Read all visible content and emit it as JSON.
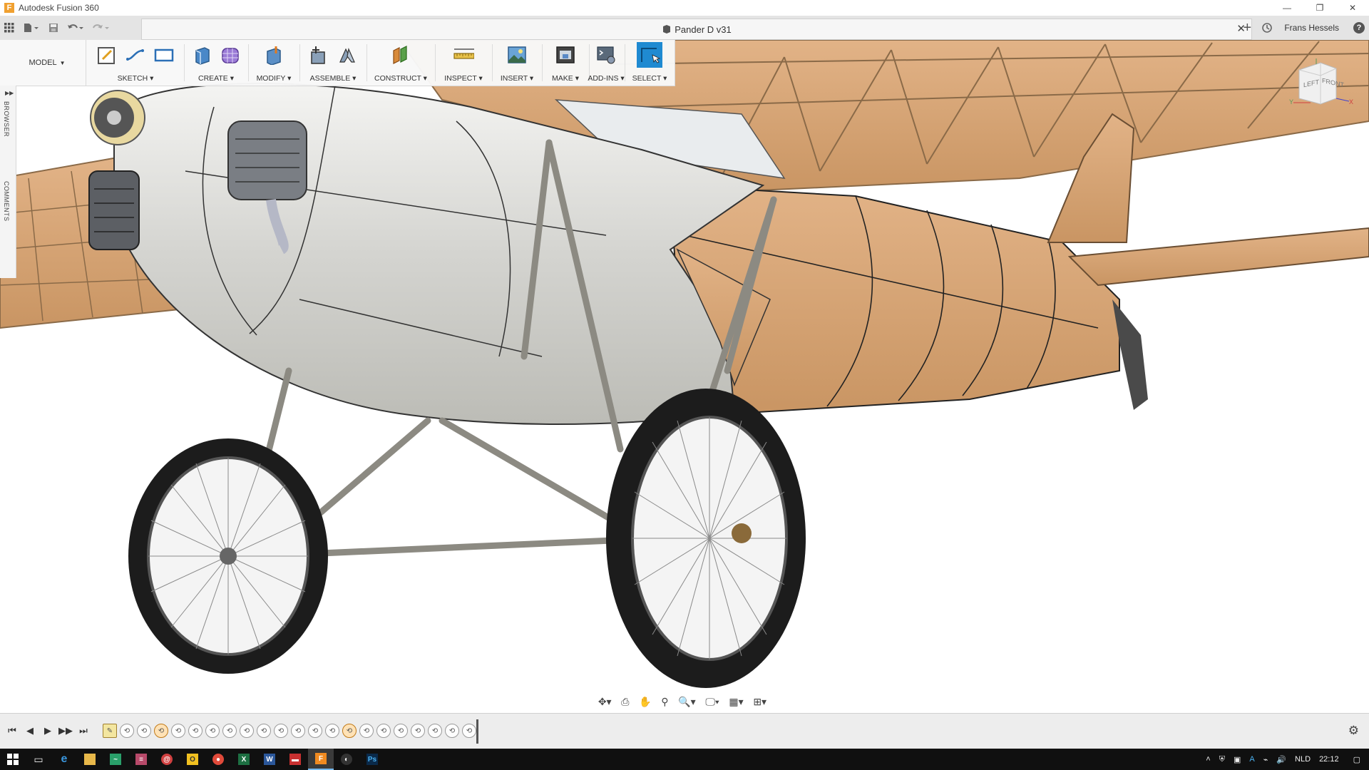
{
  "window": {
    "app_title": "Autodesk Fusion 360",
    "minimize": "—",
    "restore": "❐",
    "close": "✕"
  },
  "tabbar": {
    "document_title": "Pander D v31",
    "close": "✕",
    "new_tab": "+",
    "user_name": "Frans Hessels",
    "help": "?"
  },
  "toolbar": {
    "workspace": "MODEL",
    "groups": [
      {
        "label": "SKETCH"
      },
      {
        "label": "CREATE"
      },
      {
        "label": "MODIFY"
      },
      {
        "label": "ASSEMBLE"
      },
      {
        "label": "CONSTRUCT"
      },
      {
        "label": "INSPECT"
      },
      {
        "label": "INSERT"
      },
      {
        "label": "MAKE"
      },
      {
        "label": "ADD-INS"
      },
      {
        "label": "SELECT"
      }
    ]
  },
  "sidepanel": {
    "browser": "BROWSER",
    "comments": "COMMENTS"
  },
  "viewcube": {
    "left": "LEFT",
    "front": "FRONT",
    "axis_y": "Y",
    "axis_x": "X"
  },
  "timeline": {
    "controls": [
      "⏮",
      "◀",
      "▶",
      "▶▶",
      "⏭"
    ],
    "item_count": 22,
    "settings": "⚙"
  },
  "taskbar": {
    "tray": {
      "language": "NLD",
      "time": "22:12"
    }
  },
  "colors": {
    "select_active": "#1f8ad1",
    "wood": "#d8a676",
    "fuselage_metal": "#d6d6d2",
    "tire": "#1c1c1c"
  }
}
